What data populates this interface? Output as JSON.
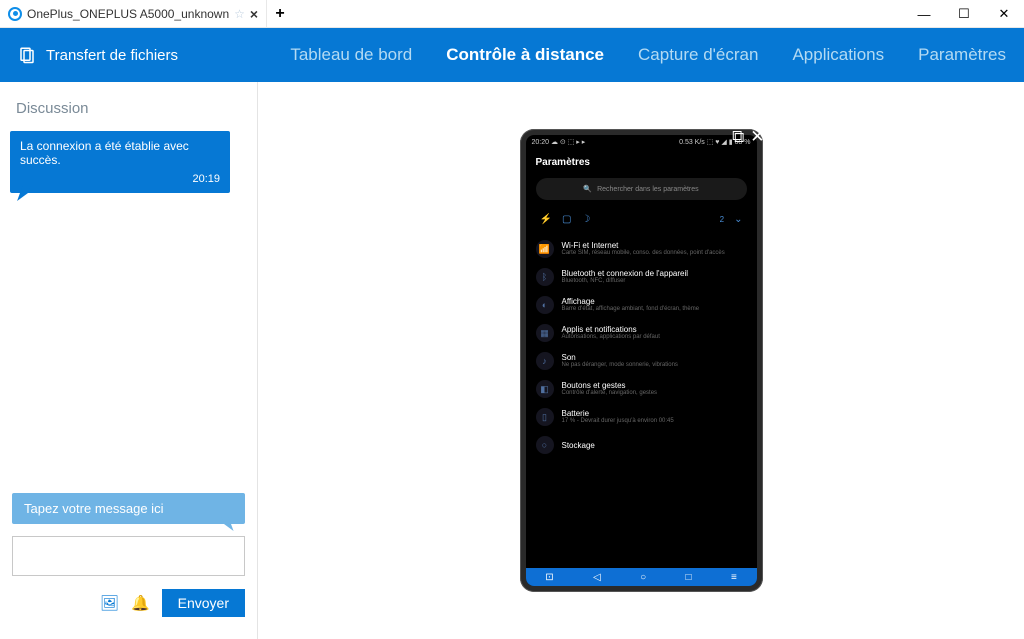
{
  "window": {
    "tab_title": "OnePlus_ONEPLUS A5000_unknown",
    "minimize": "—",
    "maximize": "☐",
    "close": "✕"
  },
  "header": {
    "transfer": "Transfert de fichiers",
    "nav": {
      "dashboard": "Tableau de bord",
      "remote": "Contrôle à distance",
      "screenshot": "Capture d'écran",
      "apps": "Applications",
      "settings": "Paramètres"
    }
  },
  "chat": {
    "title": "Discussion",
    "msg1_text": "La connexion a été établie avec succès.",
    "msg1_time": "20:19",
    "hint": "Tapez votre message ici",
    "send": "Envoyer"
  },
  "device": {
    "status_left": "20:20  ☁ ⊙ ⬚ ▸ ▸",
    "status_right": "0.53 K/s ⬚ ♥ ◢ ▮ 68 %",
    "title": "Paramètres",
    "search": "Rechercher dans les paramètres",
    "quick_count": "2",
    "rows": [
      {
        "ico": "📶",
        "t": "Wi-Fi et Internet",
        "s": "Carte SIM, réseau mobile, conso. des données, point d'accès"
      },
      {
        "ico": "ᛒ",
        "t": "Bluetooth et connexion de l'appareil",
        "s": "Bluetooth, NFC, diffuser"
      },
      {
        "ico": "◐",
        "t": "Affichage",
        "s": "Barre d'état, affichage ambiant, fond d'écran, thème"
      },
      {
        "ico": "▦",
        "t": "Applis et notifications",
        "s": "Autorisations, applications par défaut"
      },
      {
        "ico": "♪",
        "t": "Son",
        "s": "Ne pas déranger, mode sonnerie, vibrations"
      },
      {
        "ico": "◧",
        "t": "Boutons et gestes",
        "s": "Contrôle d'alerte, navigation, gestes"
      },
      {
        "ico": "▯",
        "t": "Batterie",
        "s": "17 % - Devrait durer jusqu'à environ 00:45"
      },
      {
        "ico": "○",
        "t": "Stockage",
        "s": ""
      }
    ]
  }
}
